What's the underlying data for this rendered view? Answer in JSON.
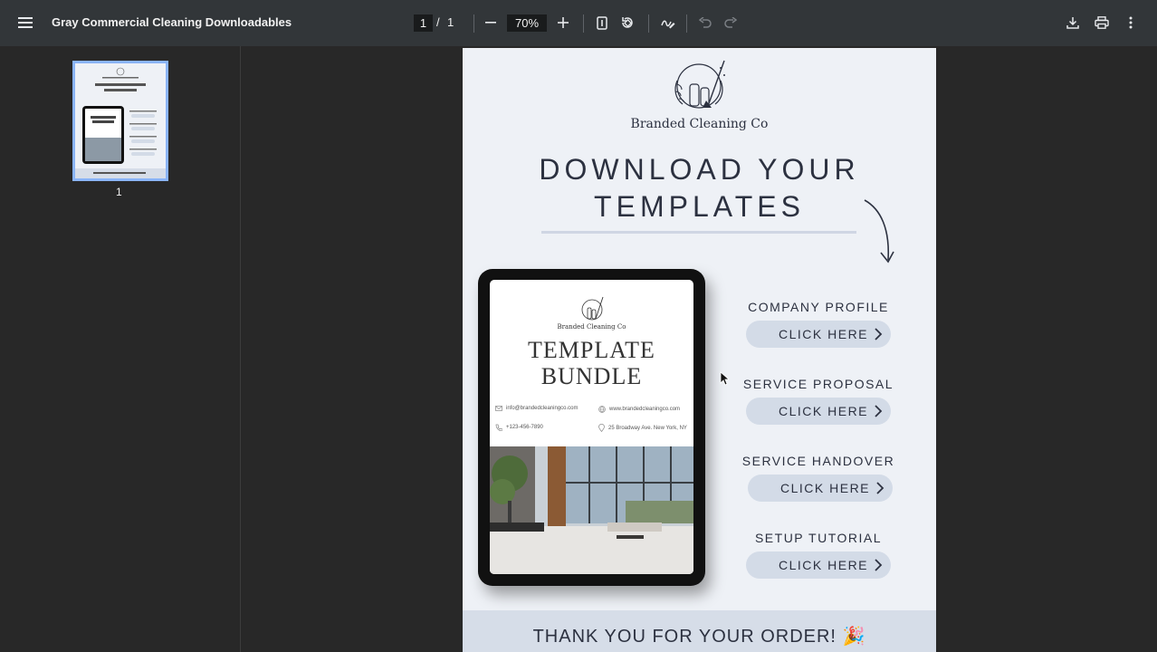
{
  "toolbar": {
    "title": "Gray Commercial Cleaning Downloadables",
    "current_page": "1",
    "page_separator": "/",
    "total_pages": "1",
    "zoom": "70%"
  },
  "sidebar": {
    "thumbnail_number": "1"
  },
  "document": {
    "brand": "Branded Cleaning Co",
    "heading_line1": "DOWNLOAD YOUR",
    "heading_line2": "TEMPLATES",
    "tablet": {
      "brand": "Branded Cleaning Co",
      "title_line1": "TEMPLATE",
      "title_line2": "BUNDLE",
      "email": "info@brandedcleaningco.com",
      "website": "www.brandedcleaningco.com",
      "phone": "+123-456-7890",
      "address": "25 Broadway Ave. New York, NY"
    },
    "sections": [
      {
        "label": "COMPANY PROFILE",
        "button": "CLICK HERE"
      },
      {
        "label": "SERVICE PROPOSAL",
        "button": "CLICK HERE"
      },
      {
        "label": "SERVICE HANDOVER",
        "button": "CLICK HERE"
      },
      {
        "label": "SETUP TUTORIAL",
        "button": "CLICK HERE"
      }
    ],
    "footer": "THANK YOU FOR YOUR ORDER! 🎉"
  },
  "colors": {
    "toolbar_bg": "#323639",
    "viewer_bg": "#282828",
    "page_bg": "#eef1f6",
    "pill_bg": "#d3dbe7",
    "text": "#2c3140",
    "thumb_border": "#8ab4f8"
  }
}
